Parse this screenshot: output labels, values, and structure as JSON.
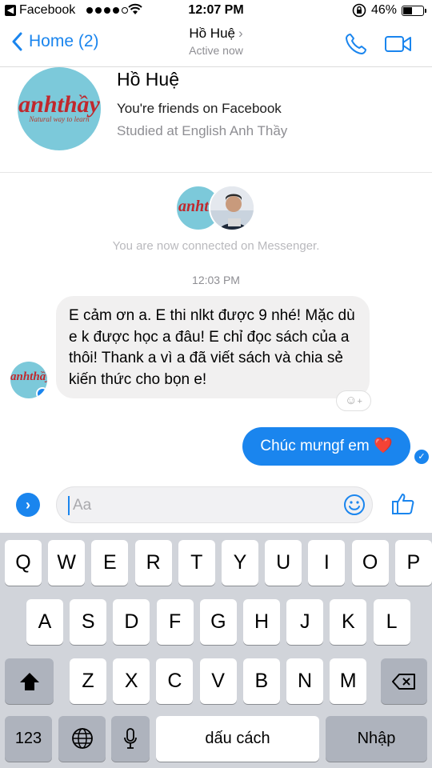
{
  "status_bar": {
    "back_app": "Facebook",
    "time": "12:07 PM",
    "battery": "46%",
    "battery_level": 0.46
  },
  "nav": {
    "back_label": "Home (2)",
    "title": "Hồ Huệ",
    "subtitle": "Active now",
    "icons": [
      "phone-icon",
      "video-camera-icon"
    ]
  },
  "profile": {
    "name": "Hồ Huệ",
    "friends_line": "You're friends on Facebook",
    "studied_line": "Studied at English Anh Thầy",
    "logo_text": "anhthầy",
    "logo_sub": "Natural way to learn"
  },
  "connection": {
    "logo_short": "anhth",
    "text": "You are now connected on Messenger."
  },
  "timestamp": "12:03 PM",
  "messages": {
    "incoming": "E cảm ơn a. E thi nlkt được 9 nhé! Mặc dù e k được học a đâu! E chỉ đọc sách của a thôi! Thank a vì a đã viết sách và chia sẻ kiến thức cho bọn e!",
    "avatar_logo": "anhthầy",
    "outgoing": "Chúc mưngf em",
    "outgoing_emoji": "❤️"
  },
  "composer": {
    "placeholder": "Aa",
    "icons": [
      "expand-icon",
      "emoji-icon",
      "thumbs-up-icon"
    ]
  },
  "keyboard": {
    "row1": [
      "Q",
      "W",
      "E",
      "R",
      "T",
      "Y",
      "U",
      "I",
      "O",
      "P"
    ],
    "row2": [
      "A",
      "S",
      "D",
      "F",
      "G",
      "H",
      "J",
      "K",
      "L"
    ],
    "row3": [
      "Z",
      "X",
      "C",
      "V",
      "B",
      "N",
      "M"
    ],
    "numbers": "123",
    "space": "dấu cách",
    "return": "Nhập"
  }
}
